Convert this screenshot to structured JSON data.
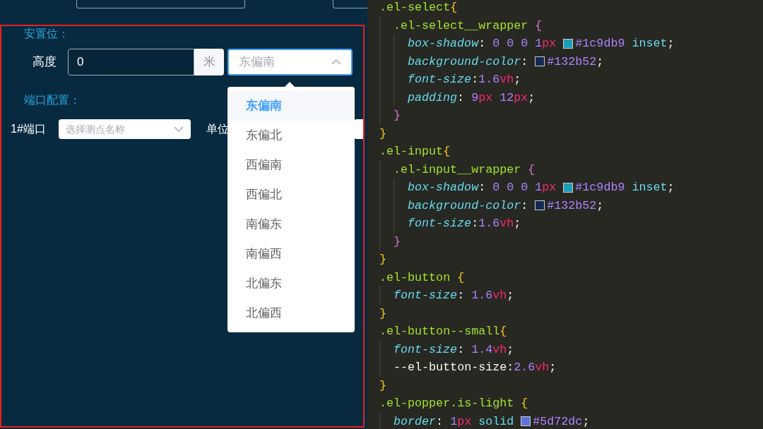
{
  "placement": {
    "heading": "安置位：",
    "height_label": "高度",
    "height_value": "0",
    "height_unit": "米",
    "direction_placeholder": "东偏南",
    "direction_open": true,
    "direction_options": [
      {
        "label": "东偏南",
        "selected": true
      },
      {
        "label": "东偏北",
        "selected": false
      },
      {
        "label": "西偏南",
        "selected": false
      },
      {
        "label": "西偏北",
        "selected": false
      },
      {
        "label": "南偏东",
        "selected": false
      },
      {
        "label": "南偏西",
        "selected": false
      },
      {
        "label": "北偏东",
        "selected": false
      },
      {
        "label": "北偏西",
        "selected": false
      }
    ]
  },
  "ports": {
    "heading": "端口配置：",
    "rows": [
      {
        "label": "1#端口",
        "placeholder": "选择测点名称",
        "unit_label": "单位"
      }
    ]
  },
  "code_lines": [
    {
      "tokens": [
        {
          "kind": "sel",
          "text": ".el-select"
        },
        {
          "kind": "brace1",
          "text": "{"
        }
      ],
      "children": [
        {
          "tokens": [
            {
              "kind": "sel",
              "text": ".el-select__wrapper "
            },
            {
              "kind": "brace2",
              "text": "{"
            }
          ],
          "children": [
            {
              "tokens": [
                {
                  "kind": "prop",
                  "text": "box-shadow"
                },
                {
                  "kind": "punct",
                  "text": ": "
                },
                {
                  "kind": "num",
                  "text": "0 0 0 1"
                },
                {
                  "kind": "unit",
                  "text": "px"
                },
                {
                  "kind": "swatch",
                  "color": "#1c9db9"
                },
                {
                  "kind": "hex",
                  "text": "#1c9db9"
                },
                {
                  "kind": "kw",
                  "text": " inset"
                },
                {
                  "kind": "punct",
                  "text": ";"
                }
              ]
            },
            {
              "tokens": [
                {
                  "kind": "prop",
                  "text": "background-color"
                },
                {
                  "kind": "punct",
                  "text": ":"
                },
                {
                  "kind": "swatch",
                  "color": "#132b52"
                },
                {
                  "kind": "hex",
                  "text": "#132b52"
                },
                {
                  "kind": "punct",
                  "text": ";"
                }
              ]
            },
            {
              "tokens": [
                {
                  "kind": "prop",
                  "text": "font-size"
                },
                {
                  "kind": "punct",
                  "text": ":"
                },
                {
                  "kind": "num",
                  "text": "1.6"
                },
                {
                  "kind": "unit",
                  "text": "vh"
                },
                {
                  "kind": "punct",
                  "text": ";"
                }
              ]
            },
            {
              "tokens": [
                {
                  "kind": "prop",
                  "text": "padding"
                },
                {
                  "kind": "punct",
                  "text": ": "
                },
                {
                  "kind": "num",
                  "text": "9"
                },
                {
                  "kind": "unit",
                  "text": "px"
                },
                {
                  "kind": "num",
                  "text": " 12"
                },
                {
                  "kind": "unit",
                  "text": "px"
                },
                {
                  "kind": "punct",
                  "text": ";"
                }
              ]
            }
          ]
        },
        {
          "tokens": [
            {
              "kind": "brace2",
              "text": "}"
            }
          ]
        }
      ]
    },
    {
      "tokens": [
        {
          "kind": "brace1",
          "text": "}"
        }
      ]
    },
    {
      "tokens": [
        {
          "kind": "sel",
          "text": ".el-input"
        },
        {
          "kind": "brace1",
          "text": "{"
        }
      ],
      "children": [
        {
          "tokens": [
            {
              "kind": "sel",
              "text": ".el-input__wrapper "
            },
            {
              "kind": "brace2",
              "text": "{"
            }
          ],
          "children": [
            {
              "tokens": [
                {
                  "kind": "prop",
                  "text": "box-shadow"
                },
                {
                  "kind": "punct",
                  "text": ": "
                },
                {
                  "kind": "num",
                  "text": "0 0 0 1"
                },
                {
                  "kind": "unit",
                  "text": "px"
                },
                {
                  "kind": "swatch",
                  "color": "#1c9db9"
                },
                {
                  "kind": "hex",
                  "text": "#1c9db9"
                },
                {
                  "kind": "kw",
                  "text": " inset"
                },
                {
                  "kind": "punct",
                  "text": ";"
                }
              ]
            },
            {
              "tokens": [
                {
                  "kind": "prop",
                  "text": "background-color"
                },
                {
                  "kind": "punct",
                  "text": ":"
                },
                {
                  "kind": "swatch",
                  "color": "#132b52"
                },
                {
                  "kind": "hex",
                  "text": "#132b52"
                },
                {
                  "kind": "punct",
                  "text": ";"
                }
              ]
            },
            {
              "tokens": [
                {
                  "kind": "prop",
                  "text": "font-size"
                },
                {
                  "kind": "punct",
                  "text": ":"
                },
                {
                  "kind": "num",
                  "text": "1.6"
                },
                {
                  "kind": "unit",
                  "text": "vh"
                },
                {
                  "kind": "punct",
                  "text": ";"
                }
              ]
            }
          ]
        },
        {
          "tokens": [
            {
              "kind": "brace2",
              "text": "}"
            }
          ]
        }
      ]
    },
    {
      "tokens": [
        {
          "kind": "brace1",
          "text": "}"
        }
      ]
    },
    {
      "tokens": [
        {
          "kind": "sel",
          "text": ".el-button "
        },
        {
          "kind": "brace1",
          "text": "{"
        }
      ],
      "children": [
        {
          "tokens": [
            {
              "kind": "prop",
              "text": "font-size"
            },
            {
              "kind": "punct",
              "text": ": "
            },
            {
              "kind": "num",
              "text": "1.6"
            },
            {
              "kind": "unit",
              "text": "vh"
            },
            {
              "kind": "punct",
              "text": ";"
            }
          ]
        }
      ]
    },
    {
      "tokens": [
        {
          "kind": "brace1",
          "text": "}"
        }
      ]
    },
    {
      "tokens": [
        {
          "kind": "sel",
          "text": ".el-button--small"
        },
        {
          "kind": "brace1",
          "text": "{"
        }
      ],
      "children": [
        {
          "tokens": [
            {
              "kind": "prop",
              "text": "font-size"
            },
            {
              "kind": "punct",
              "text": ": "
            },
            {
              "kind": "num",
              "text": "1.4"
            },
            {
              "kind": "unit",
              "text": "vh"
            },
            {
              "kind": "punct",
              "text": ";"
            }
          ]
        },
        {
          "tokens": [
            {
              "kind": "punct",
              "text": "--el-button-size:"
            },
            {
              "kind": "num",
              "text": "2.6"
            },
            {
              "kind": "unit",
              "text": "vh"
            },
            {
              "kind": "punct",
              "text": ";"
            }
          ]
        }
      ]
    },
    {
      "tokens": [
        {
          "kind": "brace1",
          "text": "}"
        }
      ]
    },
    {
      "tokens": [
        {
          "kind": "sel",
          "text": ".el-popper.is-light "
        },
        {
          "kind": "brace1",
          "text": "{"
        }
      ],
      "children": [
        {
          "tokens": [
            {
              "kind": "prop",
              "text": "border"
            },
            {
              "kind": "punct",
              "text": ": "
            },
            {
              "kind": "num",
              "text": "1"
            },
            {
              "kind": "unit",
              "text": "px"
            },
            {
              "kind": "kw",
              "text": " solid"
            },
            {
              "kind": "swatch",
              "color": "#5d72dc"
            },
            {
              "kind": "hex",
              "text": "#5d72dc"
            },
            {
              "kind": "punct",
              "text": ";"
            }
          ]
        }
      ]
    }
  ]
}
